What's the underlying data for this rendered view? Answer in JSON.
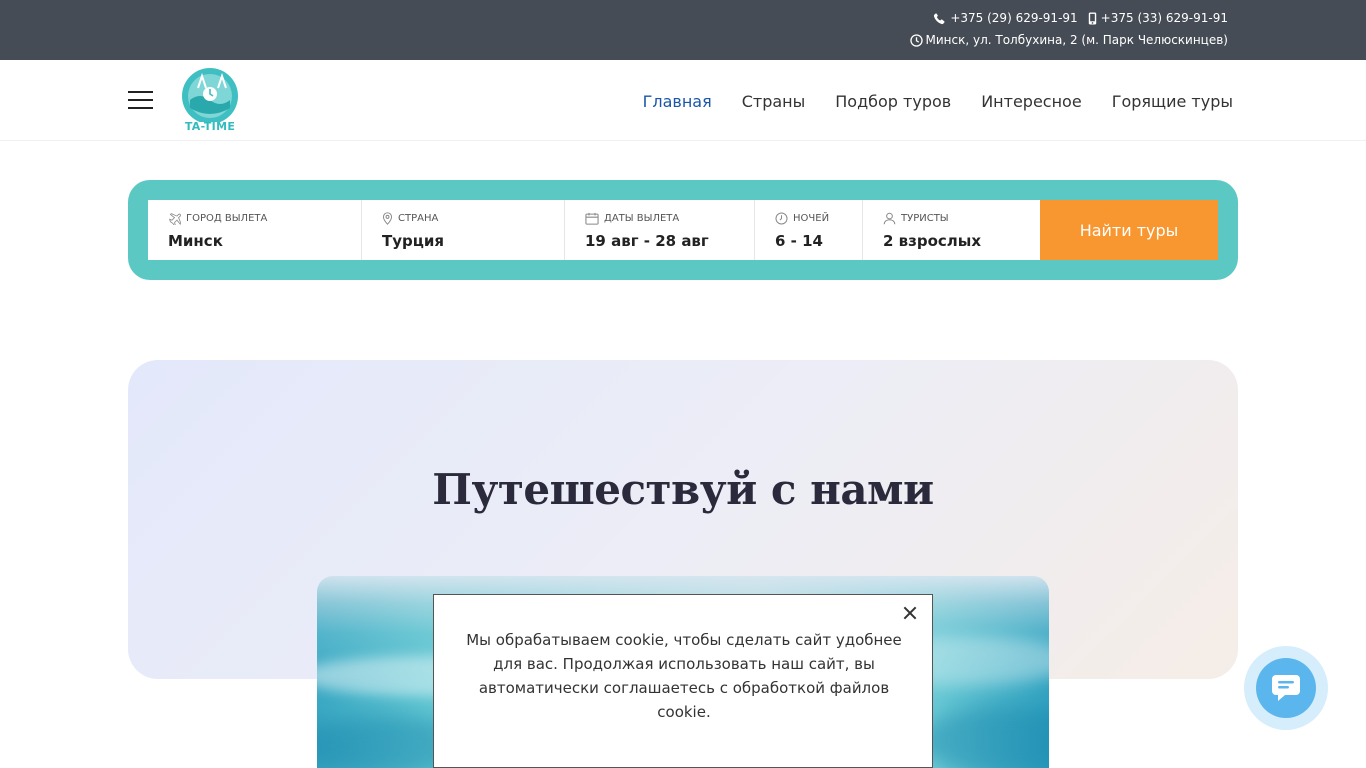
{
  "topbar": {
    "phone1": "+375 (29) 629-91-91",
    "phone2": "+375 (33) 629-91-91",
    "address": "Минск, ул. Толбухина, 2 (м. Парк Челюскинцев)",
    "icons": [
      "phone-icon",
      "mobile-icon",
      "clock-icon"
    ]
  },
  "header": {
    "logo_text": "TA-TIME",
    "nav": [
      {
        "label": "Главная",
        "active": true
      },
      {
        "label": "Страны"
      },
      {
        "label": "Подбор туров"
      },
      {
        "label": "Интересное"
      },
      {
        "label": "Горящие туры"
      }
    ]
  },
  "search": {
    "fields": [
      {
        "label": "Город вылета",
        "value": "Минск",
        "icon": "plane-icon"
      },
      {
        "label": "Страна",
        "value": "Турция",
        "icon": "location-pin-icon"
      },
      {
        "label": "Даты вылета",
        "value": "19 авг - 28 авг",
        "icon": "calendar-icon"
      },
      {
        "label": "Ночей",
        "value": "6 - 14",
        "icon": "clock-icon"
      },
      {
        "label": "Туристы",
        "value": "2 взрослых",
        "icon": "user-icon"
      }
    ],
    "button_label": "Найти туры"
  },
  "hero": {
    "title": "Путешествуй с нами"
  },
  "cookie": {
    "text": "Мы обрабатываем cookie, чтобы сделать сайт удобнее для вас. Продолжая использовать наш сайт, вы автоматически соглашаетесь с обработкой файлов cookie."
  },
  "colors": {
    "topbar_bg": "#464c55",
    "accent_teal": "#5bc8c4",
    "button_orange": "#f8962f",
    "nav_active": "#1a56a8",
    "chat_blue": "#5cb6ee"
  }
}
